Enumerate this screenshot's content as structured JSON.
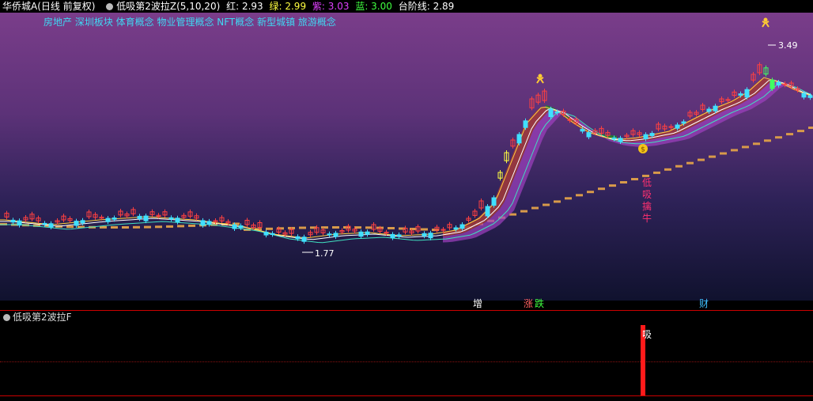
{
  "header": {
    "stock_name": "华侨城A",
    "period": "(日线 前复权)",
    "indicator": "低吸第2波拉Z(5,10,20)",
    "red_label": "红: 2.93",
    "green_label": "绿: 2.99",
    "purple_label": "紫: 3.03",
    "blue_label": "蓝: 3.00",
    "step_label": "台阶线: 2.89"
  },
  "concepts": "房地产 深圳板块 体育概念 物业管理概念 NFT概念 新型城镇 旅游概念",
  "annotations": {
    "high_price": "3.49",
    "low_price": "1.77",
    "signal_text": [
      "低",
      "吸",
      "擒",
      "牛"
    ]
  },
  "markers": {
    "zeng": "增",
    "zhang": "涨",
    "die": "跌",
    "cai": "财"
  },
  "subchart": {
    "title": "低吸第2波拉F",
    "bar_label": "吸"
  },
  "colors": {
    "red": "#ff4040",
    "green": "#ffff00",
    "purple": "#d040ff",
    "blue": "#40ff40",
    "cyan": "#3fd8f2",
    "step": "#d89a4a"
  }
}
